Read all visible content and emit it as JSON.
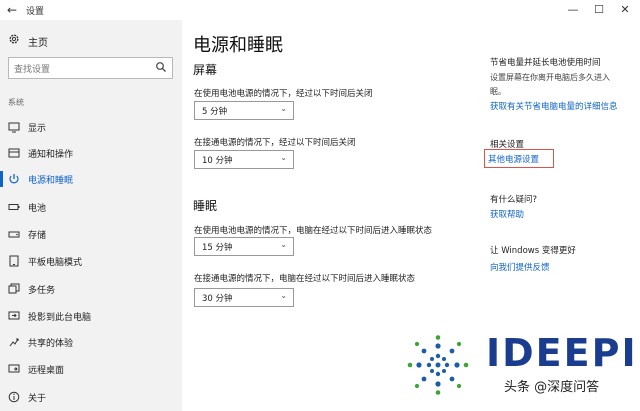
{
  "window": {
    "title": "设置"
  },
  "sidebar": {
    "home_label": "主页",
    "search_placeholder": "查找设置",
    "section_label": "系统",
    "items": [
      {
        "label": "显示",
        "icon": "monitor-icon"
      },
      {
        "label": "通知和操作",
        "icon": "notification-icon"
      },
      {
        "label": "电源和睡眠",
        "icon": "power-icon",
        "active": true
      },
      {
        "label": "电池",
        "icon": "battery-icon"
      },
      {
        "label": "存储",
        "icon": "storage-icon"
      },
      {
        "label": "平板电脑模式",
        "icon": "tablet-icon"
      },
      {
        "label": "多任务",
        "icon": "multitask-icon"
      },
      {
        "label": "投影到此台电脑",
        "icon": "project-icon"
      },
      {
        "label": "共享的体验",
        "icon": "share-icon"
      },
      {
        "label": "远程桌面",
        "icon": "remote-icon"
      },
      {
        "label": "关于",
        "icon": "info-icon"
      }
    ]
  },
  "main": {
    "title": "电源和睡眠",
    "screen": {
      "heading": "屏幕",
      "battery_label": "在使用电池电源的情况下，经过以下时间后关闭",
      "battery_value": "5 分钟",
      "plugged_label": "在接通电源的情况下，经过以下时间后关闭",
      "plugged_value": "10 分钟"
    },
    "sleep": {
      "heading": "睡眠",
      "battery_label": "在使用电池电源的情况下，电脑在经过以下时间后进入睡眠状态",
      "battery_value": "15 分钟",
      "plugged_label": "在接通电源的情况下，电脑在经过以下时间后进入睡眠状态",
      "plugged_value": "30 分钟"
    }
  },
  "right_panel": {
    "battery_tip_title": "节省电量并延长电池使用时间",
    "battery_tip_text": "设置屏幕在你离开电脑后多久进入",
    "battery_tip_text2": "眠。",
    "battery_tip_link": "获取有关节省电脑电量的详细信息",
    "related_title": "相关设置",
    "related_link": "其他电源设置",
    "question_title": "有什么疑问?",
    "help_link": "获取帮助",
    "improve_title": "让 Windows 变得更好",
    "feedback_link": "向我们提供反馈"
  },
  "watermark": {
    "brand": "IDEEPIN",
    "caption": "头条 @深度问答"
  },
  "colors": {
    "accent": "#1064c9",
    "highlight": "#d9534f",
    "sidebar_bg": "#f2f2f2"
  }
}
